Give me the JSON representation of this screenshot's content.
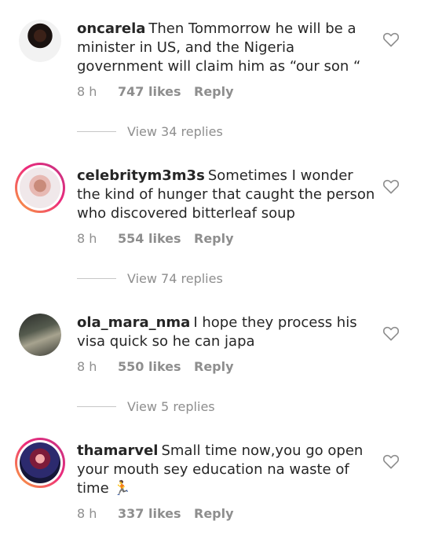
{
  "comments": [
    {
      "username": "oncarela",
      "text": "Then Tommorrow he will be a minister in US, and the Nigeria government will claim him as “our son “",
      "time": "8 h",
      "likes": "747 likes",
      "reply": "Reply",
      "view_replies": "View 34 replies",
      "avatar_ring": false,
      "like_icon": "heart-outline-icon"
    },
    {
      "username": "celebritym3m3s",
      "text": "Sometimes I wonder the kind of hunger that caught the person who discovered bitterleaf soup",
      "time": "8 h",
      "likes": "554 likes",
      "reply": "Reply",
      "view_replies": "View 74 replies",
      "avatar_ring": true,
      "like_icon": "heart-outline-icon"
    },
    {
      "username": "ola_mara_nma",
      "text": "I hope they process his visa quick so he can japa",
      "time": "8 h",
      "likes": "550 likes",
      "reply": "Reply",
      "view_replies": "View 5 replies",
      "avatar_ring": false,
      "like_icon": "heart-outline-icon"
    },
    {
      "username": "thamarvel",
      "text": "Small time now,you go open your mouth sey education na waste of time 🏃",
      "time": "8 h",
      "likes": "337 likes",
      "reply": "Reply",
      "avatar_ring": true,
      "like_icon": "heart-outline-icon"
    }
  ]
}
